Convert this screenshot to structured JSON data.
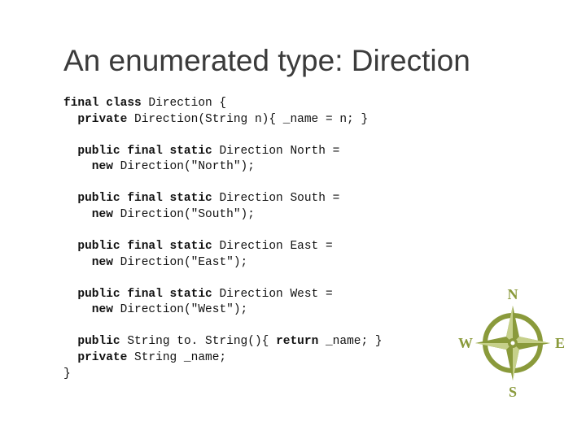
{
  "title": "An enumerated type: Direction",
  "code": {
    "l1a": "final class ",
    "l1b": "Direction {",
    "l2a": "  private ",
    "l2b": "Direction(String n){ _name = n; }",
    "l3": " ",
    "l4a": "  public final static ",
    "l4b": "Direction North =",
    "l5a": "    new ",
    "l5b": "Direction(\"North\");",
    "l6": " ",
    "l7a": "  public final static ",
    "l7b": "Direction South =",
    "l8a": "    new ",
    "l8b": "Direction(\"South\");",
    "l9": " ",
    "l10a": "  public final static ",
    "l10b": "Direction East =",
    "l11a": "    new ",
    "l11b": "Direction(\"East\");",
    "l12": " ",
    "l13a": "  public final static ",
    "l13b": "Direction West =",
    "l14a": "    new ",
    "l14b": "Direction(\"West\");",
    "l15": " ",
    "l16a": "  public ",
    "l16b": "String to. String(){ ",
    "l16c": "return ",
    "l16d": "_name; }",
    "l17a": "  private ",
    "l17b": "String _name;",
    "l18": "}"
  },
  "compass": {
    "n": "N",
    "s": "S",
    "e": "E",
    "w": "W"
  },
  "colors": {
    "accent": "#8a9a3b",
    "text": "#3b3b3b"
  }
}
